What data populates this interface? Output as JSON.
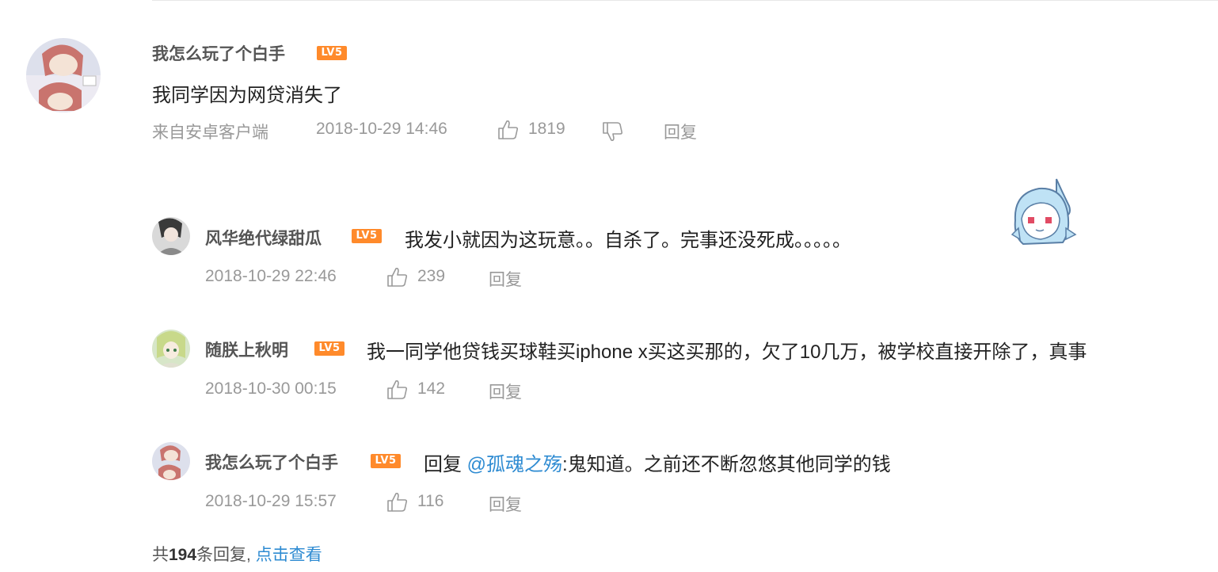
{
  "main_comment": {
    "username": "我怎么玩了个白手",
    "level": "LV5",
    "text": "我同学因为网贷消失了",
    "source": "来自安卓客户端",
    "time": "2018-10-29 14:46",
    "likes": "1819",
    "reply_label": "回复"
  },
  "replies": [
    {
      "username": "风华绝代绿甜瓜",
      "level": "LV5",
      "text": "我发小就因为这玩意。。自杀了。完事还没死成。。。。。",
      "time": "2018-10-29 22:46",
      "likes": "239",
      "reply_label": "回复"
    },
    {
      "username": "随朕上秋明",
      "level": "LV5",
      "text": "我一同学他贷钱买球鞋买iphone x买这买那的，欠了10几万，被学校直接开除了，真事",
      "time": "2018-10-30 00:15",
      "likes": "142",
      "reply_label": "回复"
    },
    {
      "username": "我怎么玩了个白手",
      "level": "LV5",
      "reply_prefix": "回复",
      "mention": "@孤魂之殇",
      "text": ":鬼知道。之前还不断忽悠其他同学的钱",
      "time": "2018-10-29 15:57",
      "likes": "116",
      "reply_label": "回复"
    }
  ],
  "footer": {
    "prefix": "共",
    "count": "194",
    "suffix": "条回复,",
    "link": "点击查看"
  },
  "colors": {
    "link": "#2e8bd2",
    "badge": "#ff8a2b",
    "meta": "#999999"
  }
}
